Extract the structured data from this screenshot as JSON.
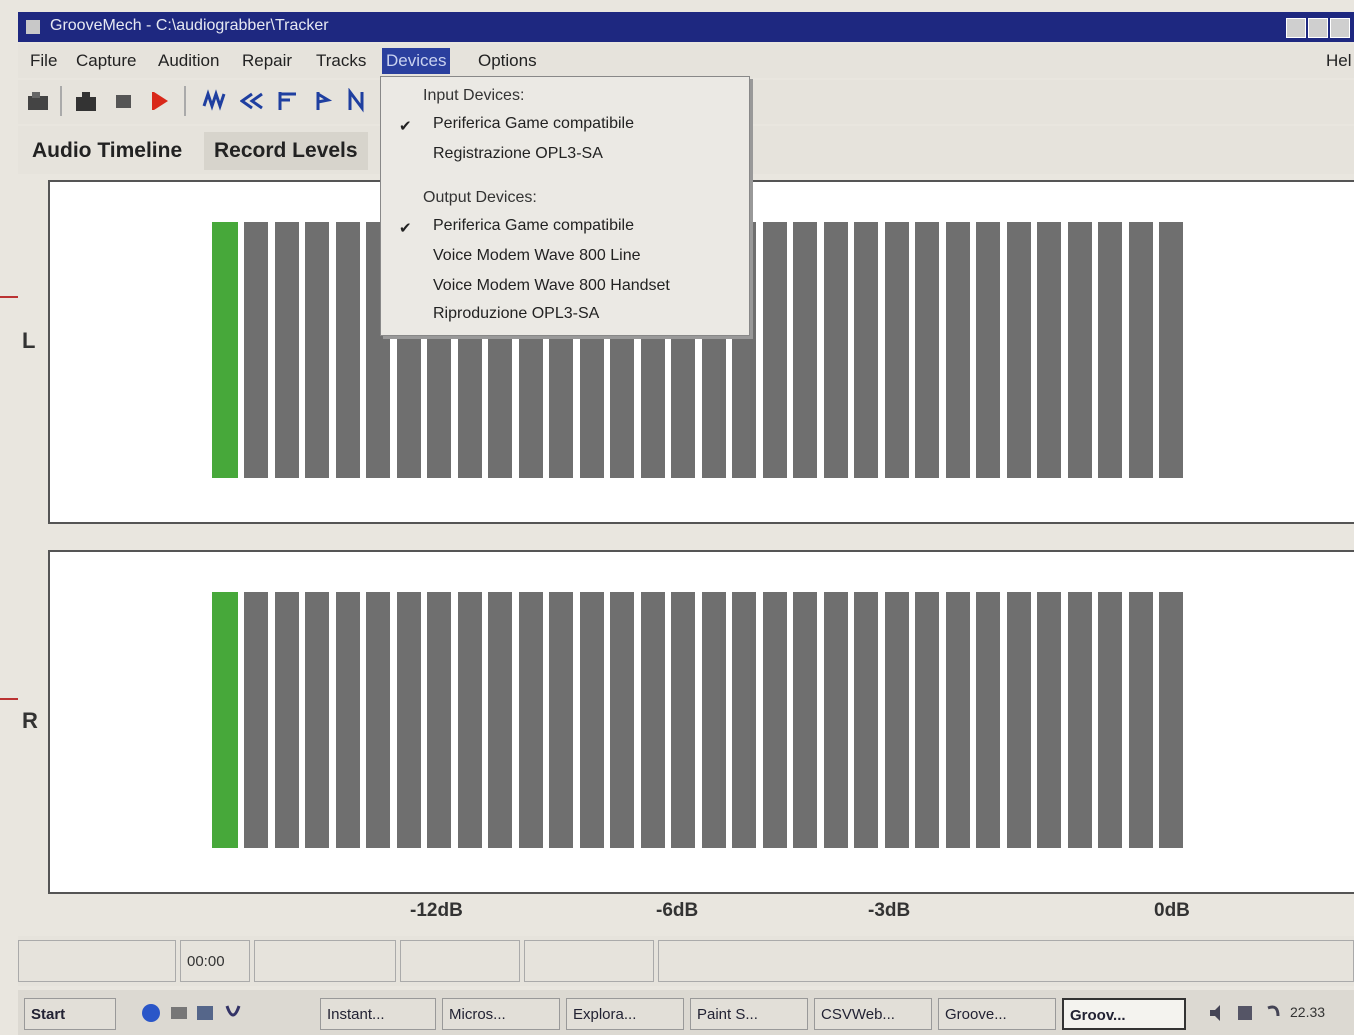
{
  "window": {
    "title": "GrooveMech - C:\\audiograbber\\Tracker",
    "right_menu": "Hel"
  },
  "menu": [
    "File",
    "Capture",
    "Audition",
    "Repair",
    "Tracks",
    "Devices",
    "Options"
  ],
  "tabs": [
    "Audio Timeline",
    "Record Levels"
  ],
  "devices_menu": {
    "input_header": "Input Devices:",
    "input_devices": [
      "Periferica Game compatibile",
      "Registrazione OPL3-SA"
    ],
    "output_header": "Output Devices:",
    "output_devices": [
      "Periferica Game compatibile",
      "Voice Modem Wave 800 Line",
      "Voice Modem Wave 800 Handset",
      "Riproduzione OPL3-SA"
    ]
  },
  "channels": [
    "L",
    "R"
  ],
  "db_labels": [
    "-12dB",
    "-6dB",
    "-3dB",
    "0dB"
  ],
  "status": {
    "time": "00:00"
  },
  "taskbar": {
    "start": "Start",
    "buttons": [
      "Instant...",
      "Micros...",
      "Explora...",
      "Paint S...",
      "CSVWeb...",
      "Groove...",
      "Groov..."
    ],
    "clock": "22.33"
  },
  "colors": {
    "titlebar": "#1e2880",
    "meter_green": "#47a83a",
    "meter_segment": "#6f6f6f",
    "menu_highlight": "#2a3f9e"
  }
}
